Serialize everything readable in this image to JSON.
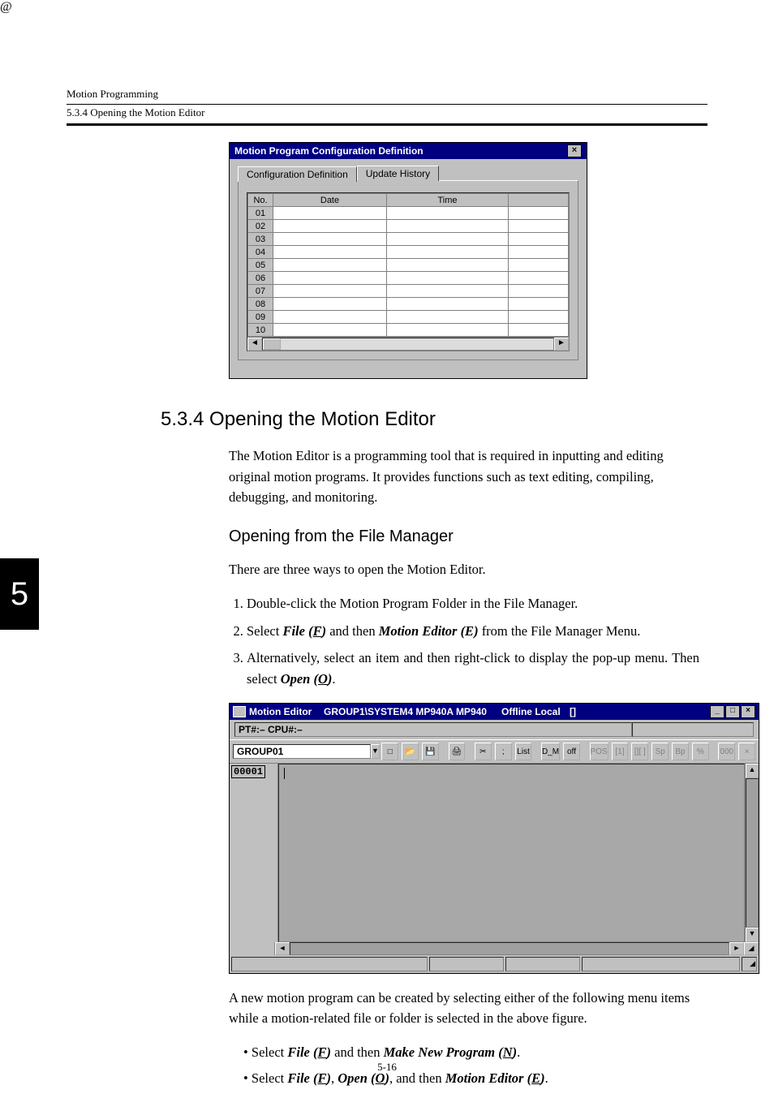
{
  "runhead": {
    "title": "Motion Programming",
    "subtitle": "5.3.4  Opening the Motion Editor"
  },
  "chapter_tab": "5",
  "page_number": "5-16",
  "fig1": {
    "dialog_title": "Motion Program Configuration Definition",
    "close_glyph": "×",
    "tabs": {
      "active": "Configuration Definition",
      "inactive": "Update History"
    },
    "headers": {
      "no": "No.",
      "date": "Date",
      "time": "Time"
    },
    "rows": [
      "01",
      "02",
      "03",
      "04",
      "05",
      "06",
      "07",
      "08",
      "09",
      "10"
    ],
    "scroll": {
      "left": "◄",
      "right": "►"
    }
  },
  "section": {
    "heading": "5.3.4  Opening the Motion Editor",
    "intro": "The Motion Editor is a programming tool that is required in inputting and editing original motion programs. It provides functions such as text editing, compiling, debugging, and monitoring.",
    "sub_heading": "Opening from the File Manager",
    "lead": "There are three ways to open the Motion Editor.",
    "steps": {
      "s1": "Double-click the Motion Program Folder in the File Manager.",
      "s2_a": "Select ",
      "s2_file": "File (",
      "s2_F": "F",
      "s2_file_close": ")",
      "s2_b": " and then ",
      "s2_me": "Motion Editor (E)",
      "s2_c": " from the File Manager Menu.",
      "s3_a": "Alternatively, select an item and then right-click to display the pop-up menu. Then select ",
      "s3_open": "Open (",
      "s3_O": "O",
      "s3_open_close": ")",
      "s3_dot": "."
    },
    "after_fig": "A new motion program can be created by selecting either of the following menu items while a motion-related file or folder is selected in the above figure.",
    "bullets": {
      "b1_a": "Select ",
      "b1_file": "File (",
      "b1_F": "F",
      "b1_file_close": ")",
      "b1_b": " and then ",
      "b1_make": "Make New Program (",
      "b1_N": "N",
      "b1_make_close": ")",
      "b1_dot": ".",
      "b2_a": "Select ",
      "b2_file": "File (",
      "b2_F": "F",
      "b2_file_close": ")",
      "b2_b": ", ",
      "b2_open": "Open (",
      "b2_O": "O",
      "b2_open_close": ")",
      "b2_c": ", and then ",
      "b2_me": "Motion Editor (",
      "b2_E": "E",
      "b2_me_close": ")",
      "b2_dot": "."
    }
  },
  "fig2": {
    "title_app": "Motion Editor",
    "title_path": "GROUP1\\SYSTEM4  MP940A  MP940",
    "title_status": "Offline  Local",
    "title_flags": "[]",
    "win_btns": {
      "min": "_",
      "max": "□",
      "close": "×"
    },
    "infobar": "PT#:– CPU#:–",
    "group": "GROUP01",
    "dd_glyph": "▼",
    "line_no": "00001",
    "toolbar_icons": [
      "□",
      "📂",
      "💾",
      "",
      "🖨",
      "",
      "✂",
      ";",
      "List",
      "",
      "D_M",
      "off",
      "",
      "POS",
      "[1]",
      "[][ ]",
      "Sp",
      "Bp",
      "%",
      "",
      "000",
      "×"
    ],
    "scroll": {
      "up": "▲",
      "down": "▼",
      "left": "◄",
      "right": "►",
      "grip": "◢"
    }
  }
}
